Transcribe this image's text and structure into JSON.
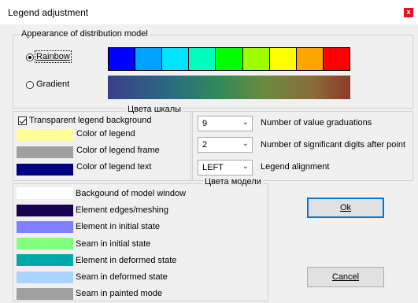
{
  "window": {
    "title": "Legend adjustment",
    "close_glyph": "x"
  },
  "distribution": {
    "group_title": "Appearance of distribution model",
    "rainbow_label": "Rainbow",
    "gradient_label": "Gradient",
    "selected": "Rainbow",
    "rainbow_colors": [
      "#0000ff",
      "#00a2ff",
      "#00e5ff",
      "#00ffbf",
      "#00ff00",
      "#9fff00",
      "#ffff00",
      "#ffa500",
      "#ff0000"
    ]
  },
  "scale_colors": {
    "group_title": "Цвета шкалы",
    "transparent_label": "Transparent legend background",
    "transparent_checked": true,
    "items": [
      {
        "label": "Color of legend",
        "color": "#ffff99"
      },
      {
        "label": "Color of legend frame",
        "color": "#a0a0a0"
      },
      {
        "label": "Color of legend text",
        "color": "#000080"
      }
    ]
  },
  "settings": {
    "graduations": {
      "value": "9",
      "label": "Number of value graduations"
    },
    "digits": {
      "value": "2",
      "label": "Number of significant digits after point"
    },
    "alignment": {
      "value": "LEFT",
      "label": "Legend alignment"
    }
  },
  "model_colors": {
    "group_title": "Цвета модели",
    "items": [
      {
        "label": "Backgound of model window",
        "color": "#ffffff"
      },
      {
        "label": "Element edges/meshing",
        "color": "#1a0050"
      },
      {
        "label": "Element in initial state",
        "color": "#8080ff"
      },
      {
        "label": "Seam in initial state",
        "color": "#80ff80"
      },
      {
        "label": "Element in deformed state",
        "color": "#00aaaa"
      },
      {
        "label": "Seam in deformed state",
        "color": "#aad4ff"
      },
      {
        "label": "Seam in painted mode",
        "color": "#a0a0a0"
      }
    ]
  },
  "buttons": {
    "ok": "Ok",
    "cancel": "Cancel"
  },
  "icons": {
    "chevron": "chevron-down-icon",
    "close": "close-icon"
  }
}
